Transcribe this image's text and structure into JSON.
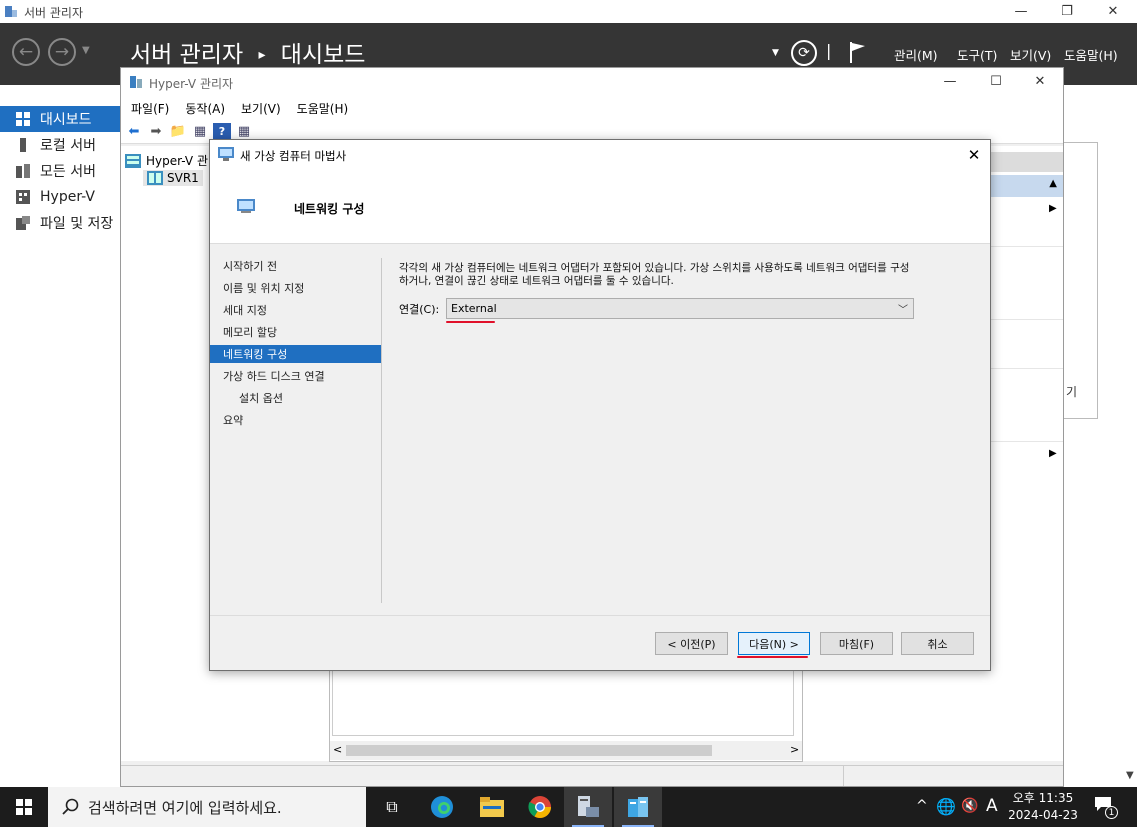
{
  "server_manager": {
    "window_title": "서버 관리자",
    "header_title": "서버 관리자",
    "header_breadcrumb": "대시보드",
    "menu": [
      "관리(M)",
      "도구(T)",
      "보기(V)",
      "도움말(H)"
    ],
    "sidebar": [
      {
        "label": "대시보드",
        "icon": "dashboard-icon",
        "active": true
      },
      {
        "label": "로컬 서버",
        "icon": "local-server-icon"
      },
      {
        "label": "모든 서버",
        "icon": "all-servers-icon"
      },
      {
        "label": "Hyper-V",
        "icon": "hyperv-icon"
      },
      {
        "label": "파일 및 저장",
        "icon": "file-storage-icon"
      }
    ],
    "right_panel_text": "기"
  },
  "hyperv_manager": {
    "window_title": "Hyper-V 관리자",
    "menu": [
      "파일(F)",
      "동작(A)",
      "보기(V)",
      "도움말(H)"
    ],
    "tree": {
      "root": "Hyper-V 관",
      "child": "SVR1"
    }
  },
  "wizard": {
    "title": "새 가상 컴퓨터 마법사",
    "page_title": "네트워킹 구성",
    "steps": [
      {
        "label": "시작하기 전"
      },
      {
        "label": "이름 및 위치 지정"
      },
      {
        "label": "세대 지정"
      },
      {
        "label": "메모리 할당"
      },
      {
        "label": "네트워킹 구성",
        "active": true
      },
      {
        "label": "가상 하드 디스크 연결"
      },
      {
        "label": "설치 옵션",
        "indent": true
      },
      {
        "label": "요약"
      }
    ],
    "description_line1": "각각의 새 가상 컴퓨터에는 네트워크 어댑터가 포함되어 있습니다. 가상 스위치를 사용하도록 네트워크 어댑터를 구성",
    "description_line2": "하거나, 연결이 끊긴 상태로 네트워크 어댑터를 둘 수 있습니다.",
    "connection_label": "연결(C):",
    "connection_value": "External",
    "buttons": {
      "previous": "< 이전(P)",
      "next": "다음(N) >",
      "finish": "마침(F)",
      "cancel": "취소"
    },
    "highlight_color": "#e0102a",
    "selection_color": "#1f6fc1"
  },
  "taskbar": {
    "search_placeholder": "검색하려면 여기에 입력하세요.",
    "input_indicator": "A",
    "clock_time": "오후 11:35",
    "clock_date": "2024-04-23",
    "notification_count": "1"
  }
}
